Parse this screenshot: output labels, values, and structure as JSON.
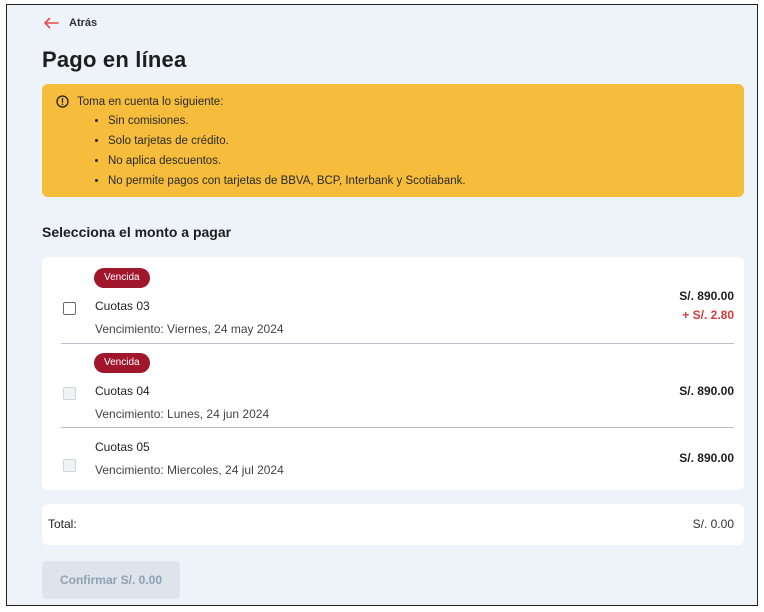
{
  "header": {
    "back_label": "Atrás",
    "title": "Pago en línea"
  },
  "notice": {
    "heading": "Toma en cuenta lo siguiente:",
    "items": [
      "Sin comisiones.",
      "Solo tarjetas de crédito.",
      "No aplica descuentos.",
      "No permite pagos con tarjetas de BBVA, BCP, Interbank y Scotiabank."
    ]
  },
  "section": {
    "title": "Selecciona el monto a pagar"
  },
  "installments": [
    {
      "badge": "Vencida",
      "name": "Cuotas 03",
      "due": "Vencimiento: Viernes, 24 may 2024",
      "amount": "S/. 890.00",
      "surcharge": "+ S/. 2.80",
      "checked": false,
      "enabled": true
    },
    {
      "badge": "Vencida",
      "name": "Cuotas 04",
      "due": "Vencimiento: Lunes, 24 jun 2024",
      "amount": "S/. 890.00",
      "checked": false,
      "enabled": false
    },
    {
      "name": "Cuotas 05",
      "due": "Vencimiento: Miercoles, 24 jul 2024",
      "amount": "S/. 890.00",
      "checked": false,
      "enabled": false
    }
  ],
  "total": {
    "label": "Total:",
    "value": "S/. 0.00"
  },
  "confirm": {
    "label": "Confirmar S/. 0.00"
  },
  "colors": {
    "notice_bg": "#f6bd3c",
    "badge_bg": "#a0162b",
    "surcharge": "#d63a3a",
    "back_arrow": "#e84a4a",
    "page_bg": "#eef2f9"
  },
  "icons": {
    "back": "arrow-left-icon",
    "notice": "info-circle-icon"
  }
}
